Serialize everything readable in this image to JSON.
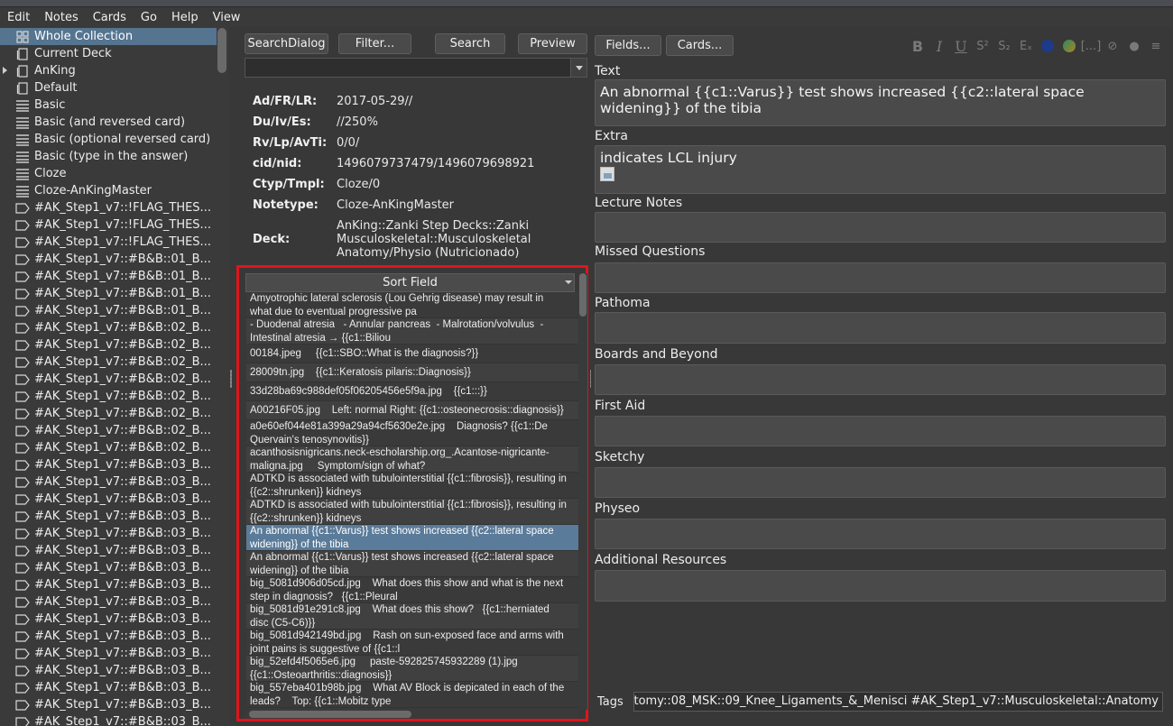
{
  "menu": [
    "Edit",
    "Notes",
    "Cards",
    "Go",
    "Help",
    "View"
  ],
  "sidebar": {
    "items": [
      {
        "label": "Whole Collection",
        "icon": "collection-icon",
        "selected": true
      },
      {
        "label": "Current Deck",
        "icon": "deck-icon"
      },
      {
        "label": "AnKing",
        "icon": "deck-icon",
        "expandable": true
      },
      {
        "label": "Default",
        "icon": "deck-icon"
      },
      {
        "label": "Basic",
        "icon": "notetype-icon"
      },
      {
        "label": "Basic (and reversed card)",
        "icon": "notetype-icon"
      },
      {
        "label": "Basic (optional reversed card)",
        "icon": "notetype-icon"
      },
      {
        "label": "Basic (type in the answer)",
        "icon": "notetype-icon"
      },
      {
        "label": "Cloze",
        "icon": "notetype-icon"
      },
      {
        "label": "Cloze-AnKingMaster",
        "icon": "notetype-icon"
      },
      {
        "label": "#AK_Step1_v7::!FLAG_THES...",
        "icon": "tag-icon"
      },
      {
        "label": "#AK_Step1_v7::!FLAG_THES...",
        "icon": "tag-icon"
      },
      {
        "label": "#AK_Step1_v7::!FLAG_THES...",
        "icon": "tag-icon"
      },
      {
        "label": "#AK_Step1_v7::#B&B::01_B...",
        "icon": "tag-icon"
      },
      {
        "label": "#AK_Step1_v7::#B&B::01_B...",
        "icon": "tag-icon"
      },
      {
        "label": "#AK_Step1_v7::#B&B::01_B...",
        "icon": "tag-icon"
      },
      {
        "label": "#AK_Step1_v7::#B&B::01_B...",
        "icon": "tag-icon"
      },
      {
        "label": "#AK_Step1_v7::#B&B::02_B...",
        "icon": "tag-icon"
      },
      {
        "label": "#AK_Step1_v7::#B&B::02_B...",
        "icon": "tag-icon"
      },
      {
        "label": "#AK_Step1_v7::#B&B::02_B...",
        "icon": "tag-icon"
      },
      {
        "label": "#AK_Step1_v7::#B&B::02_B...",
        "icon": "tag-icon"
      },
      {
        "label": "#AK_Step1_v7::#B&B::02_B...",
        "icon": "tag-icon"
      },
      {
        "label": "#AK_Step1_v7::#B&B::02_B...",
        "icon": "tag-icon"
      },
      {
        "label": "#AK_Step1_v7::#B&B::02_B...",
        "icon": "tag-icon"
      },
      {
        "label": "#AK_Step1_v7::#B&B::02_B...",
        "icon": "tag-icon"
      },
      {
        "label": "#AK_Step1_v7::#B&B::03_B...",
        "icon": "tag-icon"
      },
      {
        "label": "#AK_Step1_v7::#B&B::03_B...",
        "icon": "tag-icon"
      },
      {
        "label": "#AK_Step1_v7::#B&B::03_B...",
        "icon": "tag-icon"
      },
      {
        "label": "#AK_Step1_v7::#B&B::03_B...",
        "icon": "tag-icon"
      },
      {
        "label": "#AK_Step1_v7::#B&B::03_B...",
        "icon": "tag-icon"
      },
      {
        "label": "#AK_Step1_v7::#B&B::03_B...",
        "icon": "tag-icon"
      },
      {
        "label": "#AK_Step1_v7::#B&B::03_B...",
        "icon": "tag-icon"
      },
      {
        "label": "#AK_Step1_v7::#B&B::03_B...",
        "icon": "tag-icon"
      },
      {
        "label": "#AK_Step1_v7::#B&B::03_B...",
        "icon": "tag-icon"
      },
      {
        "label": "#AK_Step1_v7::#B&B::03_B...",
        "icon": "tag-icon"
      },
      {
        "label": "#AK_Step1_v7::#B&B::03_B...",
        "icon": "tag-icon"
      },
      {
        "label": "#AK_Step1_v7::#B&B::03_B...",
        "icon": "tag-icon"
      },
      {
        "label": "#AK_Step1_v7::#B&B::03_B...",
        "icon": "tag-icon"
      },
      {
        "label": "#AK_Step1_v7::#B&B::03_B...",
        "icon": "tag-icon"
      },
      {
        "label": "#AK_Step1_v7::#B&B::03_B...",
        "icon": "tag-icon"
      },
      {
        "label": "#AK_Step1_v7::#B&B::03_B...",
        "icon": "tag-icon"
      },
      {
        "label": "#AK_Step1_v7::#B&B::03_B...",
        "icon": "tag-icon"
      }
    ]
  },
  "search": {
    "buttons": [
      "SearchDialog",
      "Filter...",
      "Search",
      "Preview"
    ],
    "query": ""
  },
  "card_info": [
    {
      "key": "Ad/FR/LR:",
      "value": "2017-05-29//"
    },
    {
      "key": "Du/Iv/Es:",
      "value": "//250%"
    },
    {
      "key": "Rv/Lp/AvTi:",
      "value": "0/0/"
    },
    {
      "key": "cid/nid:",
      "value": "1496079737479/1496079698921"
    },
    {
      "key": "Ctyp/Tmpl:",
      "value": "Cloze/0"
    },
    {
      "key": "Notetype:",
      "value": "Cloze-AnKingMaster"
    },
    {
      "key": "Deck:",
      "value": "AnKing::Zanki Step Decks::Zanki Musculoskeletal::Musculoskeletal Anatomy/Physio (Nutricionado)"
    }
  ],
  "card_list": {
    "header": "Sort Field",
    "rows": [
      "Amyotrophic lateral sclerosis (Lou Gehrig disease) may result in\nwhat due to eventual progressive pa",
      "- Duodenal atresia   - Annular pancreas  - Malrotation/volvulus  -\nIntestinal atresia → {{c1::Biliou",
      "00184.jpeg     {{c1::SBO::What is the diagnosis?}}",
      "28009tn.jpg    {{c1::Keratosis pilaris::Diagnosis}}",
      "33d28ba69c988def05f06205456e5f9a.jpg    {{c1:::}}",
      "A00216F05.jpg    Left: normal Right: {{c1::osteonecrosis::diagnosis}}",
      "a0e60ef044e81a399a29a94cf5630e2e.jpg    Diagnosis? {{c1::De\nQuervain's tenosynovitis}}",
      "acanthosisnigricans.neck-escholarship.org_.Acantose-nigricante-\nmaligna.jpg     Symptom/sign of what?",
      "ADTKD is associated with tubulointerstitial {{c1::fibrosis}}, resulting in\n{{c2::shrunken}} kidneys",
      "ADTKD is associated with tubulointerstitial {{c1::fibrosis}}, resulting in\n{{c2::shrunken}} kidneys",
      "An abnormal {{c1::Varus}} test shows increased {{c2::lateral space\nwidening}} of the tibia",
      "An abnormal {{c1::Varus}} test shows increased {{c2::lateral space\nwidening}} of the tibia",
      "big_5081d906d05cd.jpg    What does this show and what is the next\nstep in diagnosis?   {{c1::Pleural",
      "big_5081d91e291c8.jpg    What does this show?   {{c1::herniated\ndisc (C5-C6)}}",
      "big_5081d942149bd.jpg    Rash on sun-exposed face and arms with\njoint pains is suggestive of {{c1::l",
      "big_52efd4f5065e6.jpg     paste-592825745932289 (1).jpg\n{{c1::Osteoarthritis::diagnosis}}",
      "big_557eba401b98b.jpg    What AV Block is depicated in each of the\nleads?    Top: {{c1::Mobitz type"
    ],
    "selected_index": 10
  },
  "editor": {
    "buttons": [
      "Fields...",
      "Cards..."
    ],
    "fields": [
      {
        "name": "Text",
        "content": "An abnormal {{c1::Varus}} test shows increased {{c2::lateral space widening}} of the tibia"
      },
      {
        "name": "Extra",
        "content": "indicates LCL injury"
      },
      {
        "name": "Lecture Notes",
        "content": ""
      },
      {
        "name": "Missed Questions",
        "content": ""
      },
      {
        "name": "Pathoma",
        "content": ""
      },
      {
        "name": "Boards and Beyond",
        "content": ""
      },
      {
        "name": "First Aid",
        "content": ""
      },
      {
        "name": "Sketchy",
        "content": ""
      },
      {
        "name": "Physeo",
        "content": ""
      },
      {
        "name": "Additional Resources",
        "content": ""
      }
    ],
    "tags_label": "Tags",
    "tags_value": "tomy::08_MSK::09_Knee_Ligaments_&_Menisci #AK_Step1_v7::Musculoskeletal::Anatomy",
    "toolbar_icons": [
      "bold-icon",
      "italic-icon",
      "underline-icon",
      "superscript-icon",
      "subscript-icon",
      "clear-format-icon",
      "text-color-icon",
      "highlight-color-icon",
      "cloze-icon",
      "attach-icon",
      "record-icon",
      "more-icon"
    ],
    "toolbar_glyphs": [
      "B",
      "I",
      "U",
      "S²",
      "S₂",
      "Eₓ",
      "",
      "",
      "[...]",
      "⊘",
      "●",
      "≡"
    ]
  },
  "colors": {
    "selection": "#557490",
    "list_selection": "#5a7b99",
    "highlight_border": "#e0141b",
    "text_color_swatch": "#1e3a8a"
  }
}
